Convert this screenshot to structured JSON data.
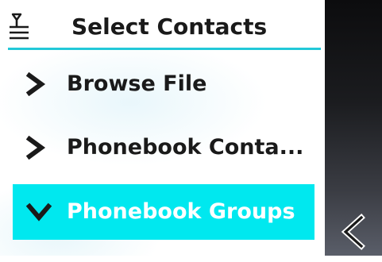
{
  "header": {
    "title": "Select Contacts",
    "icon": "contacts-menu-icon"
  },
  "menu": {
    "items": [
      {
        "label": "Browse File",
        "icon": "chevron-right-icon",
        "selected": false
      },
      {
        "label": "Phonebook Conta...",
        "icon": "chevron-right-icon",
        "selected": false
      },
      {
        "label": "Phonebook Groups",
        "icon": "chevron-down-icon",
        "selected": true
      }
    ]
  },
  "softkeys": {
    "back_icon": "chevron-left-icon"
  },
  "colors": {
    "accent": "#00e8ef",
    "underline": "#22c8d8",
    "text": "#1a1a1a",
    "softkey_bg_top": "#0c0c0e",
    "softkey_bg_bottom": "#5a5e69"
  }
}
